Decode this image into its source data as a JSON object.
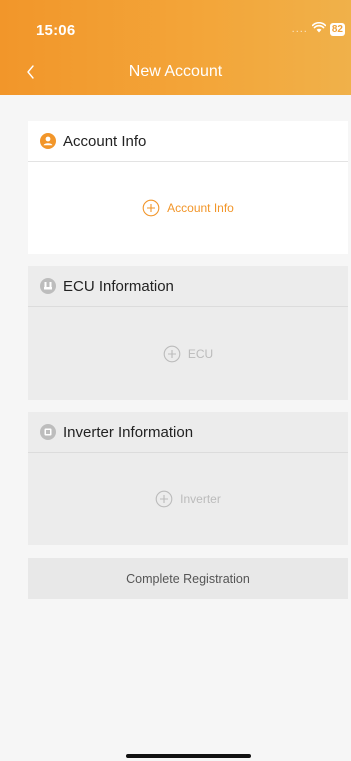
{
  "status_bar": {
    "time": "15:06",
    "signal_dots": "....",
    "battery": "82"
  },
  "nav": {
    "title": "New Account"
  },
  "account_card": {
    "title": "Account Info",
    "add_label": "Account Info"
  },
  "ecu_card": {
    "title": "ECU Information",
    "add_label": "ECU"
  },
  "inverter_card": {
    "title": "Inverter Information",
    "add_label": "Inverter"
  },
  "complete_button": {
    "label": "Complete Registration"
  },
  "colors": {
    "accent": "#f2962a",
    "disabled_text": "#bbbbbb",
    "disabled_bg": "#ececec"
  }
}
